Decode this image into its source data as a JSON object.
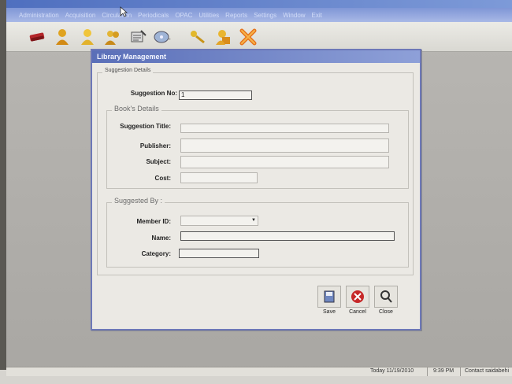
{
  "menu": {
    "items": [
      "Administration",
      "Acquisition",
      "Circulation",
      "Periodicals",
      "OPAC",
      "Utilities",
      "Reports",
      "Settings",
      "Window",
      "Exit"
    ]
  },
  "toolbar": {
    "icons": [
      "books-icon",
      "user-gold-icon",
      "user-yellow-icon",
      "users-icon",
      "issue-icon",
      "disc-icon",
      "key-icon",
      "lock-user-icon",
      "close-x-icon"
    ]
  },
  "dialog": {
    "title": "Library Management",
    "suggestion_details_legend": "Suggestion Details",
    "suggestion_no_label": "Suggestion No:",
    "suggestion_no_value": "1",
    "books_details_legend": "Book's Details",
    "suggestion_title_label": "Suggestion Title:",
    "publisher_label": "Publisher:",
    "subject_label": "Subject:",
    "cost_label": "Cost:",
    "suggested_by_legend": "Suggested By :",
    "member_id_label": "Member ID:",
    "name_label": "Name:",
    "category_label": "Category:",
    "save_label": "Save",
    "cancel_label": "Cancel",
    "close_label": "Close"
  },
  "status": {
    "date": "Today  11/19/2010",
    "time": "9:39 PM",
    "contact": "Contact  saidabehi"
  },
  "colors": {
    "dialog_border": "#6d78b8",
    "title_bar": "#5a6fb8",
    "cancel_red": "#c62828"
  }
}
